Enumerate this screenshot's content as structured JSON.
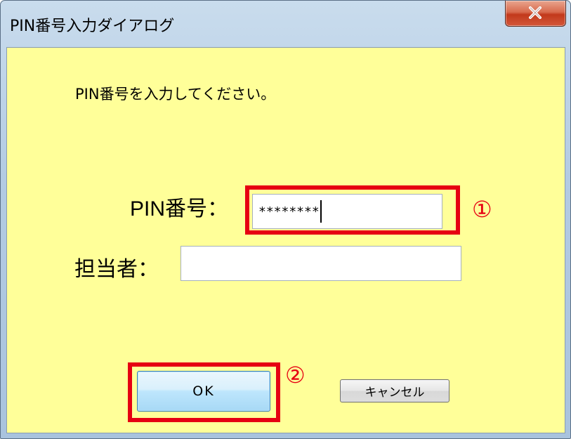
{
  "window": {
    "title": "PIN番号入力ダイアログ",
    "close_label": "x"
  },
  "dialog": {
    "prompt": "PIN番号を入力してください。",
    "pin_label": "PIN番号：",
    "pin_value": "********",
    "person_label": "担当者：",
    "person_value": "",
    "ok_label": "OK",
    "cancel_label": "キャンセル"
  },
  "annotations": {
    "marker_1": "①",
    "marker_2": "②",
    "highlight_color": "#e60012"
  },
  "colors": {
    "client_background": "#ffff99",
    "close_button": "#c2391b"
  },
  "icons": {
    "close": "close-icon"
  }
}
